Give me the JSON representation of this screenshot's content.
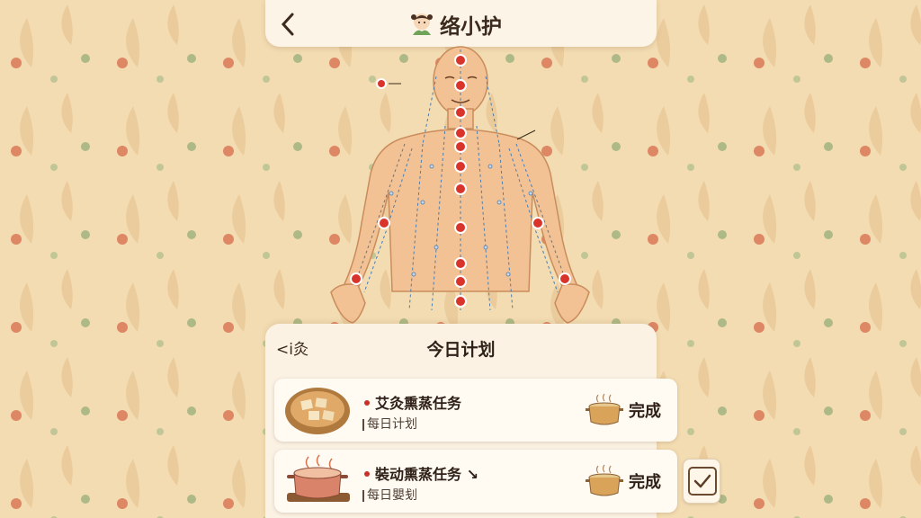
{
  "header": {
    "title": "络小护",
    "back_icon": "chevron-left-icon",
    "logo_icon": "nurse-avatar-icon"
  },
  "figure": {
    "annotation_label": "—",
    "icon": "meridian-body-chart"
  },
  "plan": {
    "left_label": "<ⅰ灸",
    "title": "今日计划"
  },
  "tasks": [
    {
      "name": "艾灸熏蒸任务",
      "subtitle": "每日计划",
      "done_label": "完成",
      "image_icon": "tofu-bowl-icon",
      "status_icon": "pot-icon"
    },
    {
      "name": "裝动熏蒸任务 ↘",
      "subtitle": "每日嬰刬",
      "done_label": "完成",
      "image_icon": "steaming-pot-icon",
      "status_icon": "pot-icon",
      "checked": true
    }
  ],
  "colors": {
    "background": "#f3dcb2",
    "card": "#fbf2e4",
    "acupoint": "#d8342b",
    "meridian": "#4a7db0"
  }
}
